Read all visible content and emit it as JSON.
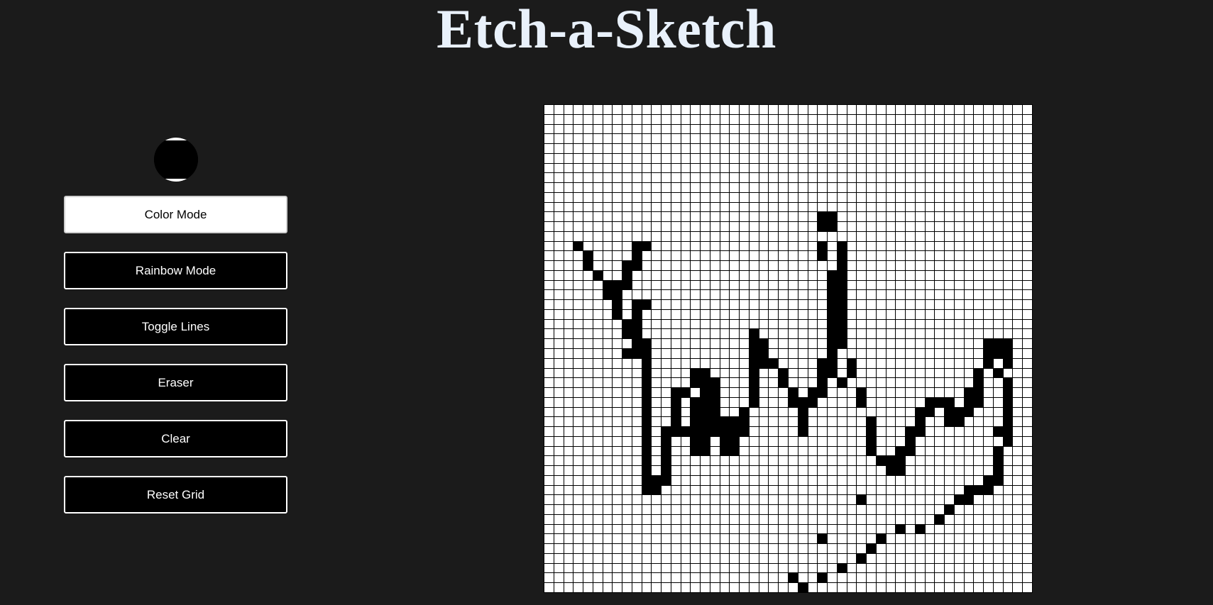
{
  "app": {
    "title": "Etch-a-Sketch"
  },
  "colors": {
    "background": "#1b1b1b",
    "title": "#e9f1fb",
    "pen_color": "#000000",
    "grid_line": "#000000",
    "cell_empty": "#ffffff"
  },
  "color_picker": {
    "value": "#000000"
  },
  "controls": {
    "color_mode": "Color Mode",
    "rainbow_mode": "Rainbow Mode",
    "toggle_lines": "Toggle Lines",
    "eraser": "Eraser",
    "clear": "Clear",
    "reset_grid": "Reset Grid",
    "active": "color_mode"
  },
  "grid": {
    "size": 50,
    "lines_visible": true,
    "filled_cells": [
      [
        12,
        29
      ],
      [
        12,
        30
      ],
      [
        13,
        29
      ],
      [
        13,
        30
      ],
      [
        15,
        4
      ],
      [
        15,
        10
      ],
      [
        15,
        11
      ],
      [
        15,
        29
      ],
      [
        15,
        31
      ],
      [
        16,
        5
      ],
      [
        16,
        10
      ],
      [
        16,
        29
      ],
      [
        16,
        31
      ],
      [
        17,
        5
      ],
      [
        17,
        9
      ],
      [
        17,
        10
      ],
      [
        17,
        31
      ],
      [
        18,
        6
      ],
      [
        18,
        9
      ],
      [
        18,
        30
      ],
      [
        18,
        31
      ],
      [
        19,
        7
      ],
      [
        19,
        8
      ],
      [
        19,
        9
      ],
      [
        19,
        30
      ],
      [
        19,
        31
      ],
      [
        20,
        7
      ],
      [
        20,
        8
      ],
      [
        20,
        30
      ],
      [
        20,
        31
      ],
      [
        21,
        8
      ],
      [
        21,
        10
      ],
      [
        21,
        11
      ],
      [
        21,
        30
      ],
      [
        21,
        31
      ],
      [
        22,
        8
      ],
      [
        22,
        10
      ],
      [
        22,
        30
      ],
      [
        22,
        31
      ],
      [
        23,
        9
      ],
      [
        23,
        10
      ],
      [
        23,
        30
      ],
      [
        23,
        31
      ],
      [
        24,
        9
      ],
      [
        24,
        10
      ],
      [
        24,
        22
      ],
      [
        24,
        30
      ],
      [
        24,
        31
      ],
      [
        25,
        10
      ],
      [
        25,
        11
      ],
      [
        25,
        22
      ],
      [
        25,
        23
      ],
      [
        25,
        30
      ],
      [
        25,
        31
      ],
      [
        25,
        46
      ],
      [
        25,
        47
      ],
      [
        25,
        48
      ],
      [
        26,
        9
      ],
      [
        26,
        10
      ],
      [
        26,
        11
      ],
      [
        26,
        22
      ],
      [
        26,
        23
      ],
      [
        26,
        30
      ],
      [
        26,
        46
      ],
      [
        26,
        47
      ],
      [
        26,
        48
      ],
      [
        27,
        11
      ],
      [
        27,
        22
      ],
      [
        27,
        23
      ],
      [
        27,
        24
      ],
      [
        27,
        29
      ],
      [
        27,
        30
      ],
      [
        27,
        32
      ],
      [
        27,
        46
      ],
      [
        27,
        48
      ],
      [
        28,
        11
      ],
      [
        28,
        16
      ],
      [
        28,
        17
      ],
      [
        28,
        22
      ],
      [
        28,
        25
      ],
      [
        28,
        29
      ],
      [
        28,
        30
      ],
      [
        28,
        32
      ],
      [
        28,
        45
      ],
      [
        28,
        47
      ],
      [
        29,
        11
      ],
      [
        29,
        16
      ],
      [
        29,
        17
      ],
      [
        29,
        18
      ],
      [
        29,
        22
      ],
      [
        29,
        25
      ],
      [
        29,
        29
      ],
      [
        29,
        31
      ],
      [
        29,
        45
      ],
      [
        29,
        48
      ],
      [
        30,
        11
      ],
      [
        30,
        14
      ],
      [
        30,
        15
      ],
      [
        30,
        17
      ],
      [
        30,
        18
      ],
      [
        30,
        22
      ],
      [
        30,
        26
      ],
      [
        30,
        28
      ],
      [
        30,
        29
      ],
      [
        30,
        33
      ],
      [
        30,
        44
      ],
      [
        30,
        45
      ],
      [
        30,
        48
      ],
      [
        31,
        11
      ],
      [
        31,
        14
      ],
      [
        31,
        16
      ],
      [
        31,
        17
      ],
      [
        31,
        18
      ],
      [
        31,
        22
      ],
      [
        31,
        26
      ],
      [
        31,
        27
      ],
      [
        31,
        28
      ],
      [
        31,
        33
      ],
      [
        31,
        40
      ],
      [
        31,
        41
      ],
      [
        31,
        42
      ],
      [
        31,
        44
      ],
      [
        31,
        45
      ],
      [
        31,
        48
      ],
      [
        32,
        11
      ],
      [
        32,
        14
      ],
      [
        32,
        16
      ],
      [
        32,
        17
      ],
      [
        32,
        18
      ],
      [
        32,
        21
      ],
      [
        32,
        27
      ],
      [
        32,
        39
      ],
      [
        32,
        40
      ],
      [
        32,
        42
      ],
      [
        32,
        43
      ],
      [
        32,
        44
      ],
      [
        32,
        48
      ],
      [
        33,
        11
      ],
      [
        33,
        14
      ],
      [
        33,
        16
      ],
      [
        33,
        17
      ],
      [
        33,
        18
      ],
      [
        33,
        19
      ],
      [
        33,
        20
      ],
      [
        33,
        21
      ],
      [
        33,
        27
      ],
      [
        33,
        34
      ],
      [
        33,
        39
      ],
      [
        33,
        42
      ],
      [
        33,
        43
      ],
      [
        33,
        48
      ],
      [
        34,
        11
      ],
      [
        34,
        13
      ],
      [
        34,
        14
      ],
      [
        34,
        15
      ],
      [
        34,
        16
      ],
      [
        34,
        17
      ],
      [
        34,
        18
      ],
      [
        34,
        19
      ],
      [
        34,
        20
      ],
      [
        34,
        21
      ],
      [
        34,
        27
      ],
      [
        34,
        34
      ],
      [
        34,
        38
      ],
      [
        34,
        39
      ],
      [
        34,
        47
      ],
      [
        34,
        48
      ],
      [
        35,
        11
      ],
      [
        35,
        13
      ],
      [
        35,
        16
      ],
      [
        35,
        17
      ],
      [
        35,
        19
      ],
      [
        35,
        20
      ],
      [
        35,
        34
      ],
      [
        35,
        38
      ],
      [
        35,
        48
      ],
      [
        36,
        11
      ],
      [
        36,
        13
      ],
      [
        36,
        16
      ],
      [
        36,
        17
      ],
      [
        36,
        19
      ],
      [
        36,
        20
      ],
      [
        36,
        34
      ],
      [
        36,
        37
      ],
      [
        36,
        38
      ],
      [
        36,
        47
      ],
      [
        37,
        11
      ],
      [
        37,
        13
      ],
      [
        37,
        35
      ],
      [
        37,
        36
      ],
      [
        37,
        37
      ],
      [
        37,
        47
      ],
      [
        38,
        11
      ],
      [
        38,
        13
      ],
      [
        38,
        36
      ],
      [
        38,
        37
      ],
      [
        38,
        47
      ],
      [
        39,
        11
      ],
      [
        39,
        12
      ],
      [
        39,
        13
      ],
      [
        39,
        46
      ],
      [
        39,
        47
      ],
      [
        40,
        11
      ],
      [
        40,
        12
      ],
      [
        40,
        44
      ],
      [
        40,
        45
      ],
      [
        40,
        46
      ],
      [
        41,
        33
      ],
      [
        41,
        43
      ],
      [
        41,
        44
      ],
      [
        42,
        42
      ],
      [
        43,
        41
      ],
      [
        44,
        37
      ],
      [
        44,
        39
      ],
      [
        45,
        29
      ],
      [
        45,
        35
      ],
      [
        46,
        34
      ],
      [
        47,
        33
      ],
      [
        48,
        31
      ],
      [
        49,
        26
      ],
      [
        49,
        29
      ],
      [
        50,
        27
      ]
    ]
  }
}
